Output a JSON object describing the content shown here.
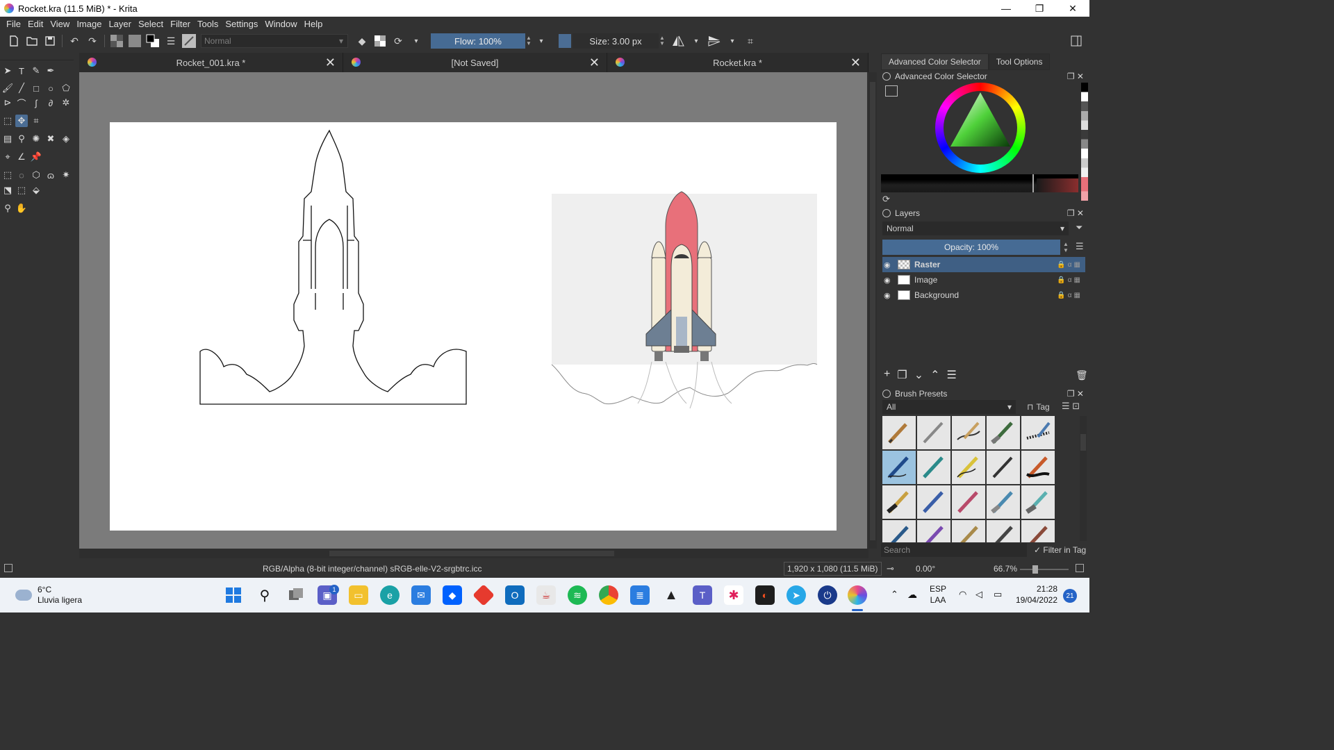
{
  "window": {
    "title": "Rocket.kra (11.5 MiB)  * - Krita",
    "controls": [
      "—",
      "❐",
      "✕"
    ]
  },
  "menu": [
    "File",
    "Edit",
    "View",
    "Image",
    "Layer",
    "Select",
    "Filter",
    "Tools",
    "Settings",
    "Window",
    "Help"
  ],
  "toolbar": {
    "blend_mode": "Normal",
    "flow": "Flow: 100%",
    "size": "Size: 3.00 px"
  },
  "tabs": [
    {
      "label": "Rocket_001.kra *"
    },
    {
      "label": "[Not Saved]"
    },
    {
      "label": "Rocket.kra *"
    }
  ],
  "dock": {
    "tabs": [
      "Advanced Color Selector",
      "Tool Options"
    ],
    "color_selector_title": "Advanced Color Selector",
    "layers": {
      "title": "Layers",
      "blend_mode": "Normal",
      "opacity": "Opacity:  100%",
      "items": [
        {
          "name": "Raster",
          "selected": true
        },
        {
          "name": "Image",
          "selected": false
        },
        {
          "name": "Background",
          "selected": false
        }
      ]
    },
    "brushes": {
      "title": "Brush Presets",
      "filter": "All",
      "tag_label": "Tag",
      "search_placeholder": "Search",
      "filter_in_tag": "Filter in Tag"
    }
  },
  "status": {
    "color_profile": "RGB/Alpha (8-bit integer/channel)  sRGB-elle-V2-srgbtrc.icc",
    "image_size": "1,920 x 1,080 (11.5 MiB)",
    "rotation": "0.00°",
    "zoom": "66.7%"
  },
  "taskbar": {
    "weather_temp": "6°C",
    "weather_desc": "Lluvia ligera",
    "chat_badge": "1",
    "lang_top": "ESP",
    "lang_bottom": "LAA",
    "time": "21:28",
    "date": "19/04/2022",
    "notifications": "21"
  },
  "colors": {
    "accent": "#466b94",
    "rocket_nose": "#e8707a",
    "rocket_body": "#f3ecd9",
    "canvas_bg": "#7b7b7b"
  }
}
